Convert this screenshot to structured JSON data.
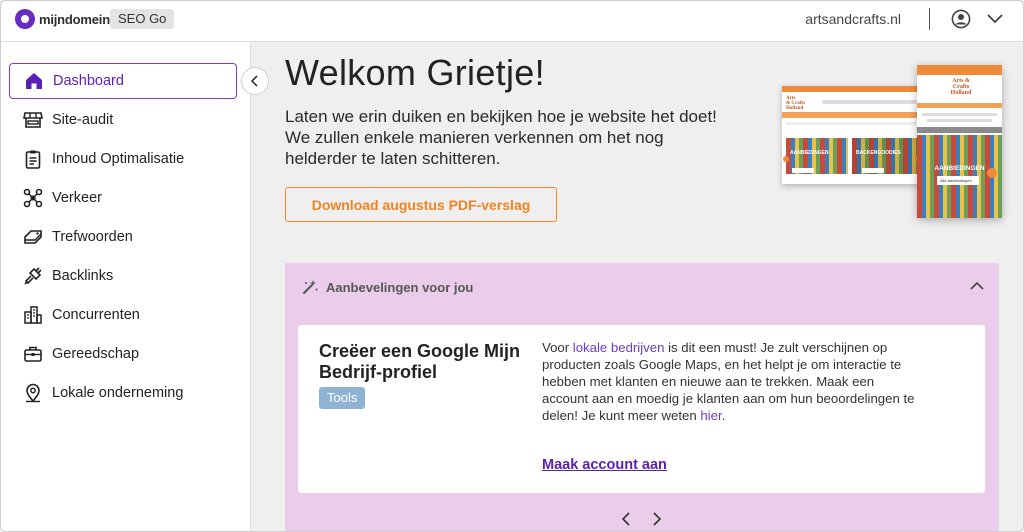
{
  "brand": {
    "name": "mijndomein",
    "product": "SEO Go",
    "accent": "#6a2bbf"
  },
  "header": {
    "domain": "artsandcrafts.nl"
  },
  "sidebar": {
    "items": [
      {
        "label": "Dashboard",
        "icon": "home-icon",
        "active": true
      },
      {
        "label": "Site-audit",
        "icon": "store-icon"
      },
      {
        "label": "Inhoud Optimalisatie",
        "icon": "clipboard-icon"
      },
      {
        "label": "Verkeer",
        "icon": "network-icon"
      },
      {
        "label": "Trefwoorden",
        "icon": "tag-stack-icon"
      },
      {
        "label": "Backlinks",
        "icon": "plug-icon"
      },
      {
        "label": "Concurrenten",
        "icon": "buildings-icon"
      },
      {
        "label": "Gereedschap",
        "icon": "toolbox-icon"
      },
      {
        "label": "Lokale onderneming",
        "icon": "map-pin-icon"
      }
    ]
  },
  "main": {
    "title": "Welkom Grietje!",
    "intro": "Laten we erin duiken en bekijken hoe je website het doet! We zullen enkele manieren verkennen om het nog helderder te laten schitteren.",
    "download_label": "Download augustus PDF-verslag",
    "download_color": "#f08a24"
  },
  "preview": {
    "desktop_labels": [
      "AANBIEDINGEN",
      "BACKENGOODIES"
    ],
    "mobile_title": "Arts & Crafts Holland",
    "mobile_banner": "AANBIEDINGEN",
    "mobile_button": "Alle aanbiedingen"
  },
  "recommendations": {
    "header": "Aanbevelingen voor jou",
    "panel_color": "#e9cdea",
    "card": {
      "title": "Creëer een Google Mijn Bedrijf-profiel",
      "tag": "Tools",
      "text_before_link": "Voor ",
      "link1": "lokale bedrijven",
      "text_middle": " is dit een must! Je zult verschijnen op producten zoals Google Maps, en het helpt je om interactie te hebben met klanten en nieuwe aan te trekken. Maak een account aan en moedig je klanten aan om hun beoordelingen te delen! Je kunt meer weten ",
      "link2": "hier",
      "text_after": ".",
      "cta": "Maak account aan"
    }
  }
}
